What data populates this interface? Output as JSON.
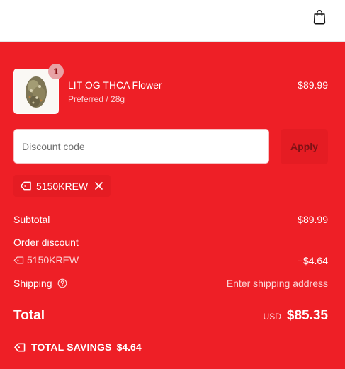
{
  "colors": {
    "panel_bg": "#ee1f26",
    "chip_bg": "#e51c23",
    "text": "#ffffff",
    "muted_text": "#fbd6d7"
  },
  "header": {
    "cart_icon": "shopping-bag-icon"
  },
  "line_item": {
    "quantity": "1",
    "name": "LIT OG THCA Flower",
    "variant": "Preferred / 28g",
    "price": "$89.99",
    "image_icon": "cannabis-flower-bud-image"
  },
  "discount": {
    "placeholder": "Discount code",
    "value": "",
    "apply_label": "Apply",
    "applied_code": "5150KREW",
    "tag_icon": "tag-icon",
    "remove_icon": "close-icon"
  },
  "summary": {
    "subtotal_label": "Subtotal",
    "subtotal_value": "$89.99",
    "order_discount_label": "Order discount",
    "discount_code": "5150KREW",
    "discount_amount": "−$4.64",
    "shipping_label": "Shipping",
    "shipping_help_icon": "question-circle-icon",
    "shipping_value": "Enter shipping address",
    "total_label": "Total",
    "currency": "USD",
    "total_amount": "$85.35",
    "savings_label": "TOTAL SAVINGS",
    "savings_amount": "$4.64",
    "savings_icon": "tag-icon"
  }
}
